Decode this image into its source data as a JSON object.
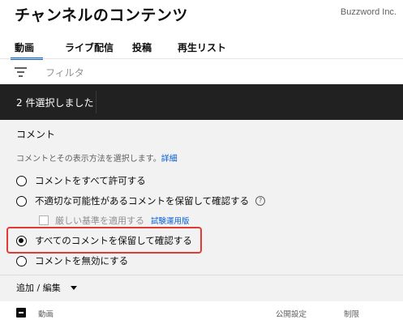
{
  "header": {
    "title": "チャンネルのコンテンツ",
    "watermark": "Buzzword Inc."
  },
  "tabs": [
    {
      "label": "動画",
      "active": true
    },
    {
      "label": "ライブ配信",
      "active": false
    },
    {
      "label": "投稿",
      "active": false
    },
    {
      "label": "再生リスト",
      "active": false
    }
  ],
  "filter": {
    "icon": "filter-icon",
    "placeholder": "フィルタ"
  },
  "selection": {
    "text": "2 件選択しました"
  },
  "comments_panel": {
    "title": "コメント",
    "description": "コメントとその表示方法を選択します。",
    "details_link": "詳細",
    "options": [
      {
        "label": "コメントをすべて許可する",
        "checked": false
      },
      {
        "label": "不適切な可能性があるコメントを保留して確認する",
        "checked": false,
        "has_help": true
      },
      {
        "label": "すべてのコメントを保留して確認する",
        "checked": true
      },
      {
        "label": "コメントを無効にする",
        "checked": false
      }
    ],
    "strict": {
      "label": "厳しい基準を適用する",
      "badge": "試験運用版",
      "checked": false
    },
    "help_glyph": "?"
  },
  "add_edit": {
    "label": "追加 / 編集"
  },
  "table": {
    "columns": [
      "動画",
      "公開設定",
      "制限"
    ]
  },
  "colors": {
    "accent": "#065fd4",
    "selection_bar": "#212121",
    "highlight": "#e53935",
    "panel_bg": "#f2f2f2"
  }
}
